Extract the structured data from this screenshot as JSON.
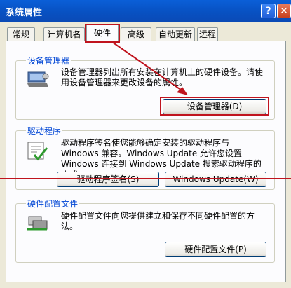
{
  "window": {
    "title": "系统属性",
    "help_glyph": "?",
    "close_glyph": "✕"
  },
  "tabs": [
    {
      "label": "常规"
    },
    {
      "label": "计算机名"
    },
    {
      "label": "硬件",
      "active": true
    },
    {
      "label": "高级"
    },
    {
      "label": "自动更新"
    },
    {
      "label": "远程"
    }
  ],
  "device_manager": {
    "title": "设备管理器",
    "description": "设备管理器列出所有安装在计算机上的硬件设备。请使用设备管理器来更改设备的属性。",
    "button": "设备管理器(D)",
    "icon": "device-manager-icon"
  },
  "drivers": {
    "title": "驱动程序",
    "description": "驱动程序签名使您能够确定安装的驱动程序与 Windows 兼容。Windows Update 允许您设置 Windows 连接到 Windows Update 搜索驱动程序的方式。",
    "sign_button": "驱动程序签名(S)",
    "update_button": "Windows Update(W)",
    "icon": "driver-signing-icon"
  },
  "profiles": {
    "title": "硬件配置文件",
    "description": "硬件配置文件向您提供建立和保存不同硬件配置的方法。",
    "button": "硬件配置文件(P)",
    "icon": "hardware-profiles-icon"
  },
  "colors": {
    "highlight": "#C0141E",
    "title_blue": "#0A5FD8",
    "group_title": "#0046D5"
  }
}
